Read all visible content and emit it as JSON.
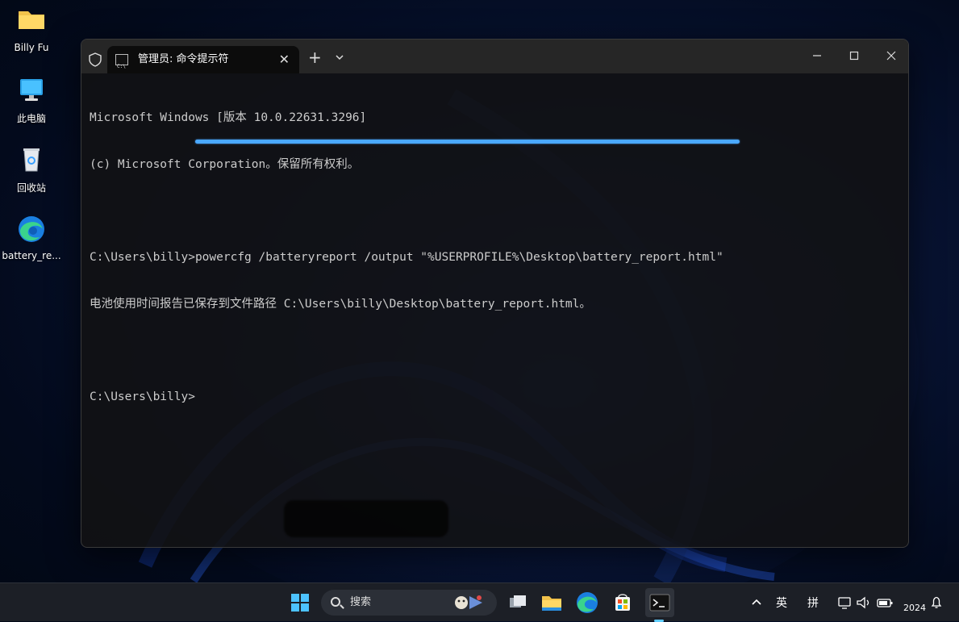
{
  "desktop": {
    "icons": [
      {
        "label": "Billy Fu",
        "icon": "folder-icon"
      },
      {
        "label": "此电脑",
        "icon": "monitor-icon"
      },
      {
        "label": "回收站",
        "icon": "recycle-bin-icon"
      },
      {
        "label": "battery_re...",
        "icon": "edge-icon"
      }
    ]
  },
  "window": {
    "tab_title": "管理员: 命令提示符",
    "new_tab_label": "+",
    "terminal_lines": [
      "Microsoft Windows [版本 10.0.22631.3296]",
      "(c) Microsoft Corporation。保留所有权利。",
      "",
      "C:\\Users\\billy>powercfg /batteryreport /output \"%USERPROFILE%\\Desktop\\battery_report.html\"",
      "电池使用时间报告已保存到文件路径 C:\\Users\\billy\\Desktop\\battery_report.html。",
      "",
      "C:\\Users\\billy>"
    ]
  },
  "taskbar": {
    "search_placeholder": "搜索",
    "ime_lang": "英",
    "ime_mode": "拼",
    "clock_year": "2024"
  },
  "colors": {
    "accent": "#4aa8ff",
    "terminal_text": "#cccccc",
    "taskbar_bg": "#1c1f26"
  }
}
